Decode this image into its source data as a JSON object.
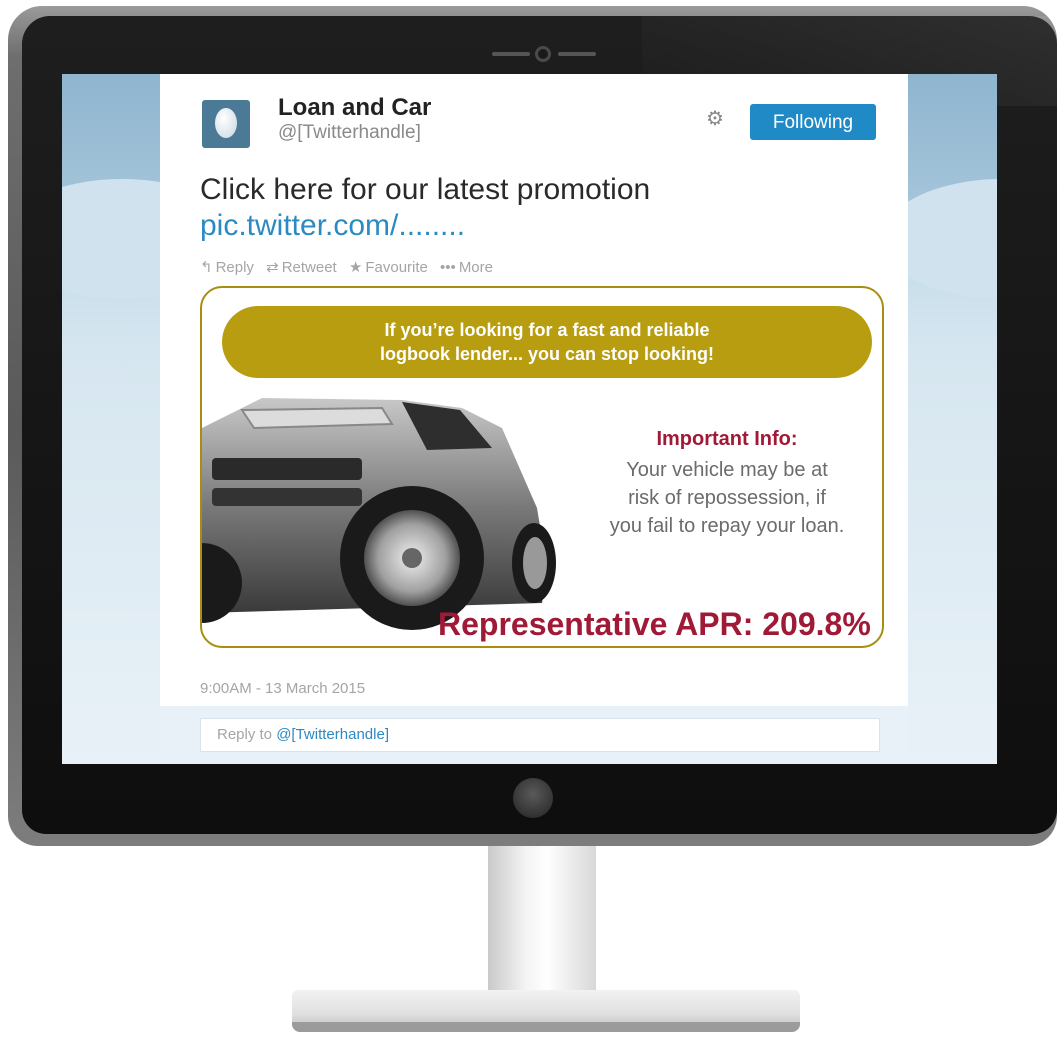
{
  "tweet": {
    "display_name": "Loan and Car",
    "handle": "@[Twitterhandle]",
    "follow_label": "Following",
    "text": "Click here for our latest promotion",
    "link": "pic.twitter.com/........",
    "actions": {
      "reply": "Reply",
      "retweet": "Retweet",
      "favourite": "Favourite",
      "more": "More"
    },
    "timestamp": "9:00AM - 13 March 2015",
    "reply_prefix": "Reply to",
    "reply_handle": "@[Twitterhandle]"
  },
  "ad": {
    "banner_line1": "If you’re looking for a fast and reliable",
    "banner_line2": "logbook lender... you can stop looking!",
    "info_title": "Important Info:",
    "info_line1": "Your vehicle may be at",
    "info_line2": "risk of repossession, if",
    "info_line3": "you fail to repay your loan.",
    "apr": "Representative APR: 209.8%"
  },
  "icons": {
    "gear": "gear-icon",
    "reply": "reply-icon",
    "retweet": "retweet-icon",
    "favourite": "star-icon",
    "more": "more-dots-icon",
    "avatar": "egg-avatar"
  },
  "colors": {
    "follow_button": "#1f8ac5",
    "link": "#2b8ac2",
    "banner": "#b89d10",
    "accent_red": "#a01936"
  }
}
